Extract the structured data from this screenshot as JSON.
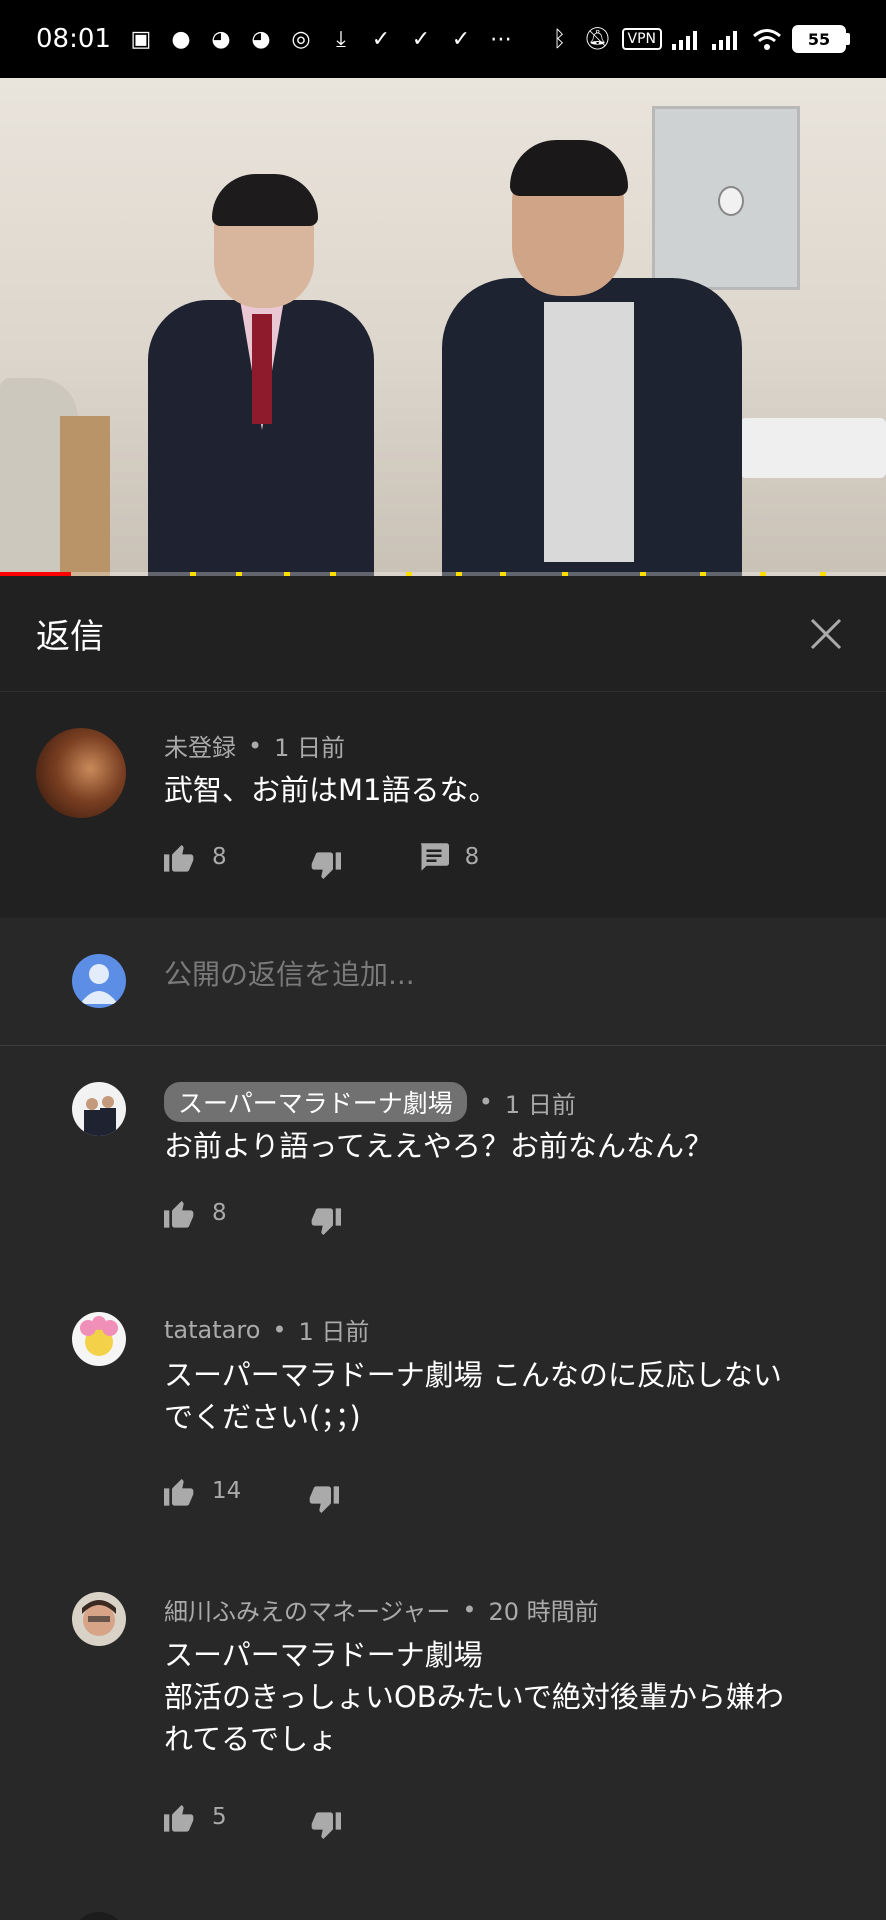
{
  "status_bar": {
    "time": "08:01",
    "vpn": "VPN",
    "battery": "55"
  },
  "header": {
    "title": "返信"
  },
  "top_comment": {
    "author": "未登録",
    "time": "1 日前",
    "text": "武智、お前はM1語るな。",
    "likes": "8",
    "replies": "8"
  },
  "add_reply": {
    "placeholder": "公開の返信を追加..."
  },
  "replies": [
    {
      "author": "スーパーマラドーナ劇場",
      "time": "1 日前",
      "text": "お前より語ってええやろ？お前なんなん？",
      "likes": "8"
    },
    {
      "author": "tatataro",
      "time": "1 日前",
      "text_line1": "スーパーマラドーナ劇場 こんなのに反応しない",
      "text_line2": "でください(；；)",
      "likes": "14"
    },
    {
      "author": "細川ふみえのマネージャー",
      "time": "20 時間前",
      "text_line1": "スーパーマラドーナ劇場",
      "text_line2": "部活のきっしょいOBみたいで絶対後輩から嫌わ",
      "text_line3": "れてるでしょ",
      "likes": "5"
    }
  ],
  "colors": {
    "background": "#212121",
    "reply_background": "#282828",
    "progress": "#ff0000",
    "chip": "#717171",
    "secondary_text": "#aaaaaa"
  },
  "progress": {
    "played_fraction": 0.08
  }
}
